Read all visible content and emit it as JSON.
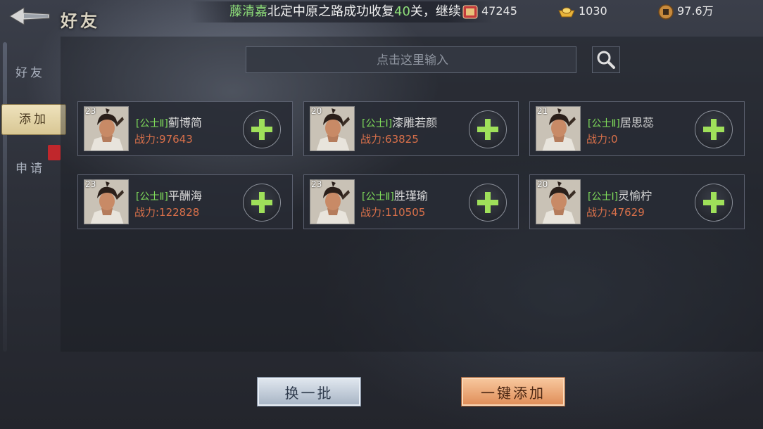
{
  "header": {
    "title": "好友",
    "back_icon": "back-arrow-icon",
    "ticker": {
      "prefix": "",
      "player": "藤清嘉",
      "text1": "北定中原之路成功收复",
      "number": "40",
      "text2": "关，",
      "suffix": "继续"
    },
    "resources": [
      {
        "icon": "stamina-icon",
        "value": "47245"
      },
      {
        "icon": "gold-ingot-icon",
        "value": "1030"
      },
      {
        "icon": "copper-coin-icon",
        "value": "97.6万"
      }
    ]
  },
  "sidebar": {
    "tabs": [
      {
        "label": "好友",
        "active": false
      },
      {
        "label": "添加",
        "active": true
      },
      {
        "label": "申请",
        "active": false
      }
    ]
  },
  "search": {
    "placeholder": "点击这里输入",
    "value": "",
    "icon": "search-icon"
  },
  "players": [
    {
      "level": "23",
      "title": "[公士Ⅱ]",
      "name": "蓟博简",
      "power": "战力:97643"
    },
    {
      "level": "20",
      "title": "[公士Ⅰ]",
      "name": "漆雕若颜",
      "power": "战力:63825"
    },
    {
      "level": "21",
      "title": "[公士Ⅱ]",
      "name": "居思蕊",
      "power": "战力:0"
    },
    {
      "level": "23",
      "title": "[公士Ⅱ]",
      "name": "平酬海",
      "power": "战力:122828"
    },
    {
      "level": "23",
      "title": "[公士Ⅱ]",
      "name": "胜瑾瑜",
      "power": "战力:110505"
    },
    {
      "level": "20",
      "title": "[公士Ⅰ]",
      "name": "灵愉柠",
      "power": "战力:47629"
    }
  ],
  "footer": {
    "refresh_label": "换一批",
    "add_all_label": "一键添加"
  },
  "colors": {
    "title_green": "#7fdc5a",
    "power_orange": "#d9704a",
    "accent_orange": "#e08f5a"
  }
}
